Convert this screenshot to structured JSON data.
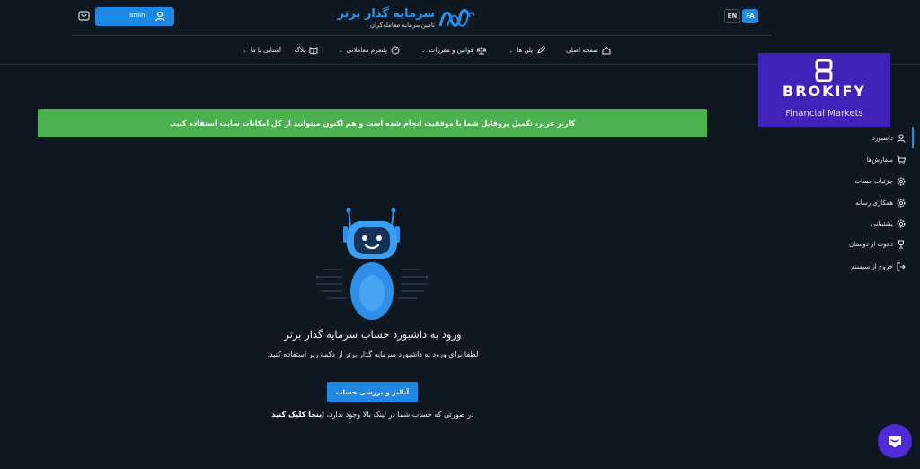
{
  "header": {
    "lang_fa": "FA",
    "lang_en": "EN",
    "logo_title": "سرمایه گذار برتر",
    "logo_subtitle": "تامین‌سرمایه معامله‌گران",
    "user_name": "amin"
  },
  "nav": {
    "items": [
      {
        "label": "صفحه اصلی",
        "icon": "home-icon"
      },
      {
        "label": "پلن ها",
        "icon": "rocket-icon"
      },
      {
        "label": "قوانین و مقررات",
        "icon": "scale-icon"
      },
      {
        "label": "پلتفرم معاملاتی",
        "icon": "gauge-icon"
      },
      {
        "label": "بلاگ",
        "icon": "book-icon"
      },
      {
        "label": "آشنایی با ما",
        "icon": ""
      }
    ]
  },
  "alert": {
    "text": "کاربر عزیز، تکمیل پروفایل شما با موفقیت انجام شده است و هم اکنون میتوانید از کل امکانات سایت استفاده کنید."
  },
  "main": {
    "title": "ورود به داشبورد حساب سرمایه گذار برتر",
    "description": "لطفا برای ورود به داشبورد سرمایه گذار برتر از دکمه زیر استفاده کنید.",
    "button_label": "آنالیز و بررسی حساب",
    "note_text": "در صورتی که حساب شما در لینک بالا وجود ندارد،",
    "note_link": "اینجا کلیک کنید"
  },
  "brand": {
    "name": "BROKIFY",
    "subtitle": "Financial Markets"
  },
  "sidebar": {
    "items": [
      {
        "label": "داشبورد",
        "icon": "user-icon",
        "active": true
      },
      {
        "label": "سفارش‌ها",
        "icon": "cart-icon"
      },
      {
        "label": "جزئیات حساب",
        "icon": "gear-icon"
      },
      {
        "label": "همکاری رسانه",
        "icon": "gear-icon"
      },
      {
        "label": "پشتیبانی",
        "icon": "gear-icon"
      },
      {
        "label": "دعوت از دوستان",
        "icon": "trophy-icon"
      },
      {
        "label": "خروج از سیستم",
        "icon": "logout-icon"
      }
    ]
  },
  "colors": {
    "background": "#0f1820",
    "accent": "#1e88e5",
    "success": "#4caf50",
    "brand": "#3f22b7",
    "chat": "#4d2bd6"
  }
}
